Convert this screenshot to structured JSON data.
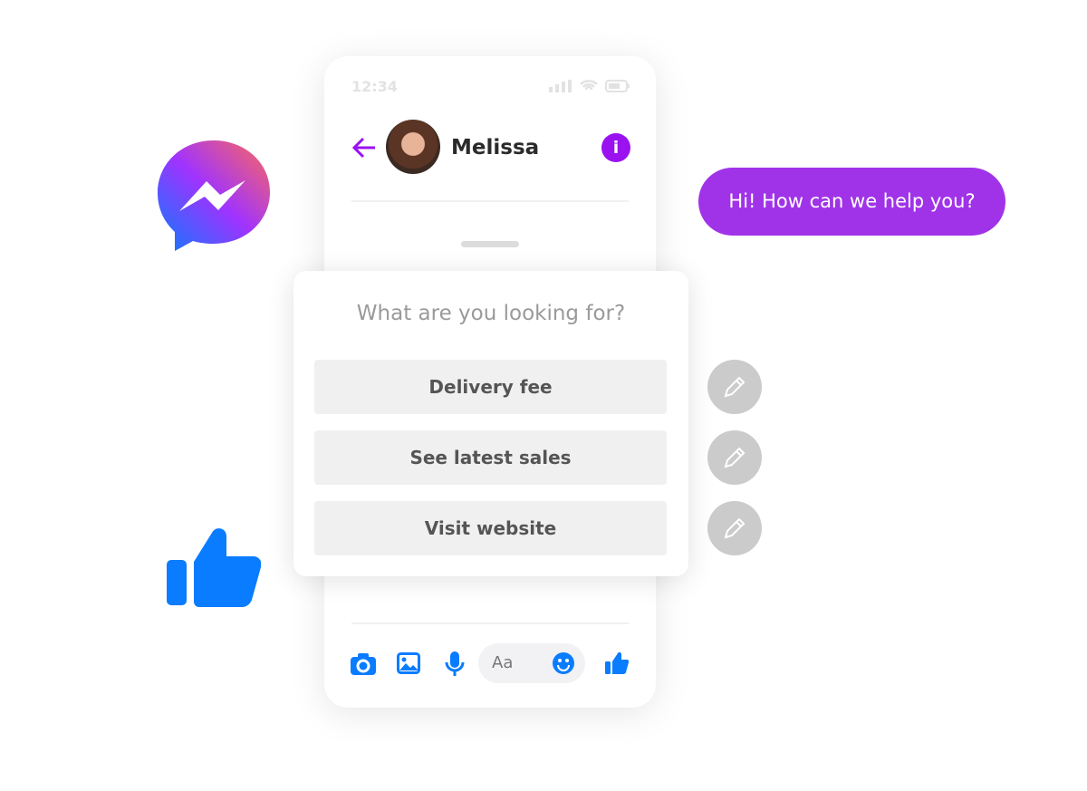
{
  "phone": {
    "time": "12:34",
    "contact_name": "Melissa",
    "composer_placeholder": "Aa"
  },
  "popup": {
    "question": "What are you looking for?",
    "options": [
      {
        "label": "Delivery fee"
      },
      {
        "label": "See latest sales"
      },
      {
        "label": "Visit website"
      }
    ]
  },
  "bubble": {
    "text": "Hi! How can we help you?"
  },
  "colors": {
    "accent_purple": "#9a12f0",
    "bubble": "#a033e8",
    "messenger_blue": "#0a7cff",
    "pencil_bg": "#cbcbcb"
  }
}
